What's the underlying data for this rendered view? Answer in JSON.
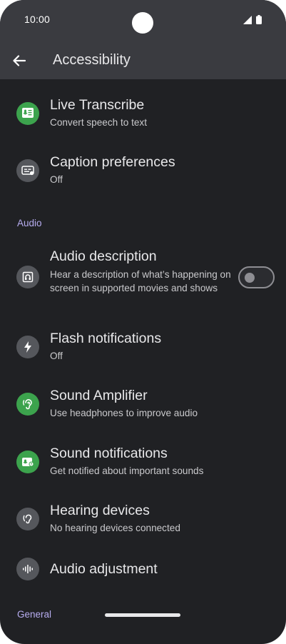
{
  "status": {
    "time": "10:00"
  },
  "header": {
    "title": "Accessibility"
  },
  "items_top": [
    {
      "title": "Live Transcribe",
      "subtitle": "Convert speech to text",
      "icon": "live-transcribe-icon"
    },
    {
      "title": "Caption preferences",
      "subtitle": "Off",
      "icon": "caption-icon"
    }
  ],
  "section_audio": "Audio",
  "audio_items": [
    {
      "title": "Audio description",
      "subtitle": "Hear a description of what’s happening on screen in supported movies and shows",
      "icon": "audio-description-icon",
      "toggle_on": false
    },
    {
      "title": "Flash notifications",
      "subtitle": "Off",
      "icon": "flash-icon"
    },
    {
      "title": "Sound Amplifier",
      "subtitle": "Use headphones to improve audio",
      "icon": "ear-icon"
    },
    {
      "title": "Sound notifications",
      "subtitle": "Get notified about important sounds",
      "icon": "sound-notification-icon"
    },
    {
      "title": "Hearing devices",
      "subtitle": "No hearing devices connected",
      "icon": "hearing-device-icon"
    },
    {
      "title": "Audio adjustment",
      "icon": "waveform-icon"
    }
  ],
  "section_general": "General",
  "colors": {
    "background": "#202124",
    "appbar": "#3a3b40",
    "accent_green": "#3ca34d",
    "section_label": "#b7adf0"
  }
}
